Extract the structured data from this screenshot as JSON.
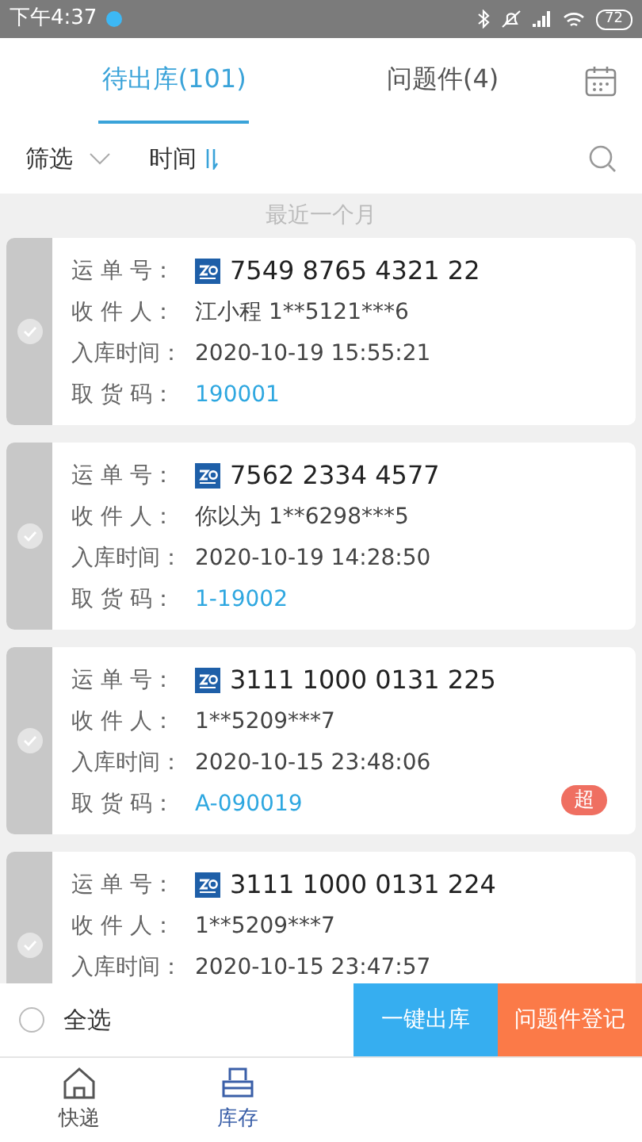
{
  "status_bar": {
    "time": "下午4:37",
    "battery": "72"
  },
  "tabs": [
    {
      "label": "待出库(101)",
      "selected": true
    },
    {
      "label": "问题件(4)",
      "selected": false
    }
  ],
  "filter_bar": {
    "filter": "筛选",
    "sort": "时间"
  },
  "section_label": "最近一个月",
  "shipments": [
    {
      "selected": false,
      "rows": [
        {
          "kind": "waybill",
          "label": "运 单 号：",
          "value": "7549 8765 4321 22"
        },
        {
          "kind": "text",
          "label": "收 件 人：",
          "value": "江小程 1**5121***6"
        },
        {
          "kind": "text",
          "label": "入库时间：",
          "value": "2020-10-19 15:55:21"
        },
        {
          "kind": "code",
          "label": "取 货 码：",
          "value": "190001"
        }
      ]
    },
    {
      "selected": false,
      "rows": [
        {
          "kind": "waybill",
          "label": "运 单 号：",
          "value": "7562 2334 4577"
        },
        {
          "kind": "text",
          "label": "收 件 人：",
          "value": "你以为 1**6298***5"
        },
        {
          "kind": "text",
          "label": "入库时间：",
          "value": "2020-10-19 14:28:50"
        },
        {
          "kind": "code",
          "label": "取 货 码：",
          "value": "1-19002"
        }
      ]
    },
    {
      "selected": false,
      "badge": "超",
      "rows": [
        {
          "kind": "waybill",
          "label": "运 单 号：",
          "value": "3111 1000 0131 225"
        },
        {
          "kind": "text",
          "label": "收 件 人：",
          "value": "1**5209***7"
        },
        {
          "kind": "text",
          "label": "入库时间：",
          "value": "2020-10-15 23:48:06"
        },
        {
          "kind": "code",
          "label": "取 货 码：",
          "value": "A-090019"
        }
      ]
    },
    {
      "selected": false,
      "rows": [
        {
          "kind": "waybill",
          "label": "运 单 号：",
          "value": "3111 1000 0131 224"
        },
        {
          "kind": "text",
          "label": "收 件 人：",
          "value": "1**5209***7"
        },
        {
          "kind": "text",
          "label": "入库时间：",
          "value": "2020-10-15 23:47:57"
        }
      ]
    }
  ],
  "action_bar": {
    "select_all": {
      "label": "全选",
      "checked": false
    },
    "buttons": [
      {
        "kind": "primary",
        "label": "一键出库"
      },
      {
        "kind": "warning",
        "label": "问题件登记"
      }
    ]
  },
  "bottom_nav": [
    {
      "label": "快递",
      "kind": "home",
      "selected": false
    },
    {
      "label": "库存",
      "kind": "stock",
      "selected": true
    }
  ]
}
